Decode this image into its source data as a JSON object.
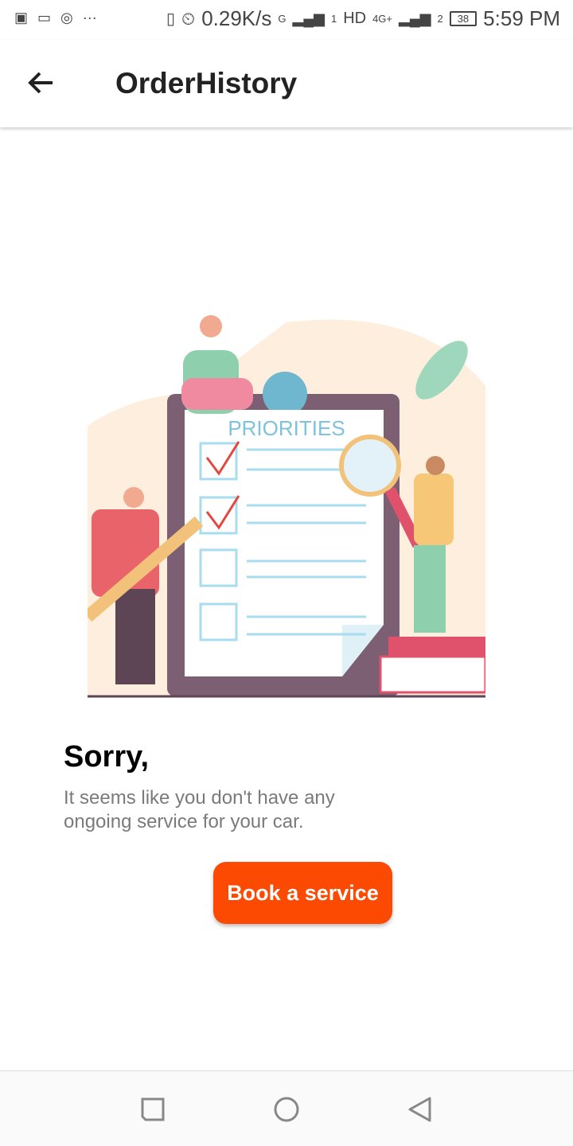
{
  "status_bar": {
    "net_speed": "0.29K/s",
    "sim1_label": "G",
    "sim1_slot": "1",
    "hd": "HD",
    "network": "4G+",
    "sim2_slot": "2",
    "battery": "38",
    "time": "5:59 PM"
  },
  "header": {
    "title": "OrderHistory"
  },
  "illustration": {
    "clipboard_title": "PRIORITIES"
  },
  "empty_state": {
    "heading": "Sorry,",
    "message": "It seems like you don't have any ongoing service for your car.",
    "button": "Book a service"
  },
  "colors": {
    "accent": "#fc4a03"
  }
}
